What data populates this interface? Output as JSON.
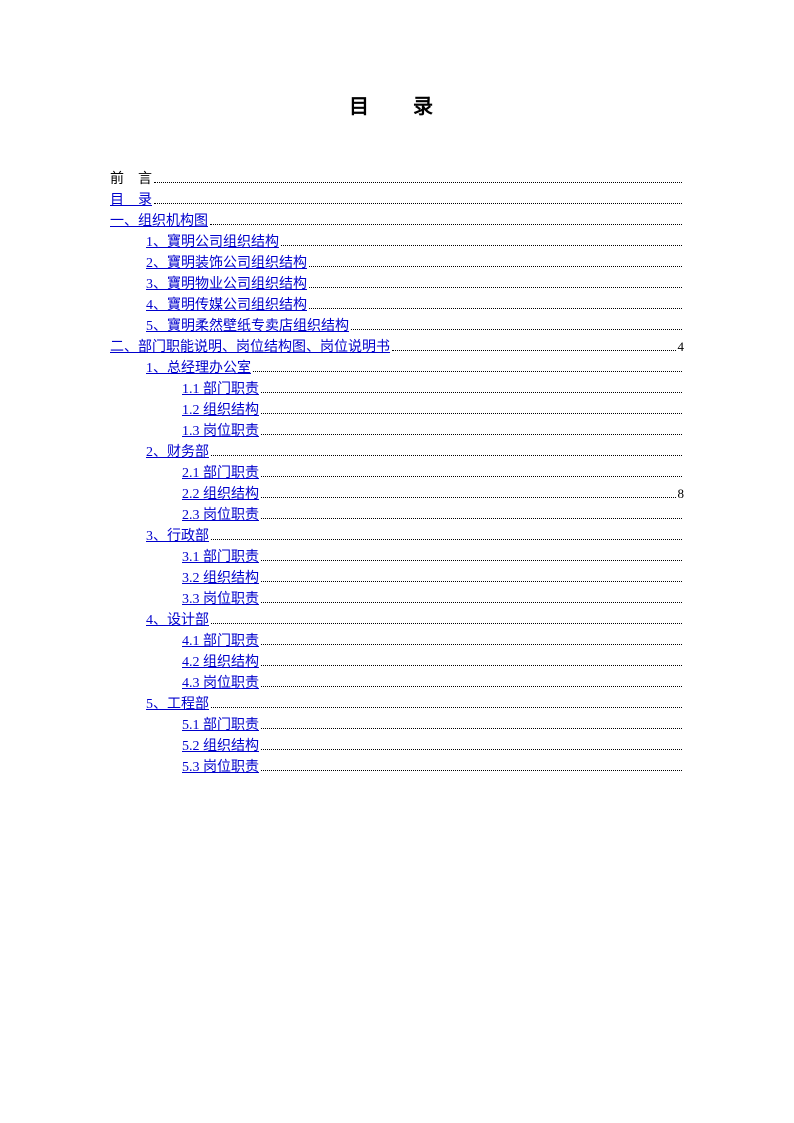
{
  "title": "目　录",
  "entries": [
    {
      "label": "前　言",
      "indent": 0,
      "link": false,
      "page": ""
    },
    {
      "label": "目　录",
      "indent": 0,
      "link": true,
      "page": ""
    },
    {
      "label": "一、组织机构图",
      "indent": 0,
      "link": true,
      "page": ""
    },
    {
      "label": "1、寶明公司组织结构",
      "indent": 1,
      "link": true,
      "page": ""
    },
    {
      "label": "2、寶明装饰公司组织结构",
      "indent": 1,
      "link": true,
      "page": ""
    },
    {
      "label": "3、寶明物业公司组织结构",
      "indent": 1,
      "link": true,
      "page": ""
    },
    {
      "label": "4、寶明传媒公司组织结构",
      "indent": 1,
      "link": true,
      "page": ""
    },
    {
      "label": "5、寶明柔然壁纸专卖店组织结构",
      "indent": 1,
      "link": true,
      "page": ""
    },
    {
      "label": "二、部门职能说明、岗位结构图、岗位说明书",
      "indent": 0,
      "link": true,
      "page": "4"
    },
    {
      "label": "1、总经理办公室",
      "indent": 1,
      "link": true,
      "page": ""
    },
    {
      "label": "1.1 部门职责",
      "indent": 2,
      "link": true,
      "page": ""
    },
    {
      "label": "1.2 组织结构",
      "indent": 2,
      "link": true,
      "page": ""
    },
    {
      "label": "1.3 岗位职责",
      "indent": 2,
      "link": true,
      "page": ""
    },
    {
      "label": "2、财务部",
      "indent": 1,
      "link": true,
      "page": ""
    },
    {
      "label": "2.1 部门职责",
      "indent": 2,
      "link": true,
      "page": ""
    },
    {
      "label": "2.2 组织结构",
      "indent": 2,
      "link": true,
      "page": "8"
    },
    {
      "label": "2.3 岗位职责",
      "indent": 2,
      "link": true,
      "page": ""
    },
    {
      "label": "3、行政部",
      "indent": 1,
      "link": true,
      "page": ""
    },
    {
      "label": "3.1 部门职责",
      "indent": 2,
      "link": true,
      "page": ""
    },
    {
      "label": "3.2 组织结构",
      "indent": 2,
      "link": true,
      "page": ""
    },
    {
      "label": "3.3 岗位职责",
      "indent": 2,
      "link": true,
      "page": ""
    },
    {
      "label": "4、设计部",
      "indent": 1,
      "link": true,
      "page": ""
    },
    {
      "label": "4.1 部门职责",
      "indent": 2,
      "link": true,
      "page": ""
    },
    {
      "label": "4.2 组织结构",
      "indent": 2,
      "link": true,
      "page": ""
    },
    {
      "label": "4.3 岗位职责",
      "indent": 2,
      "link": true,
      "page": ""
    },
    {
      "label": "5、工程部",
      "indent": 1,
      "link": true,
      "page": ""
    },
    {
      "label": "5.1 部门职责",
      "indent": 2,
      "link": true,
      "page": ""
    },
    {
      "label": "5.2 组织结构",
      "indent": 2,
      "link": true,
      "page": ""
    },
    {
      "label": "5.3 岗位职责",
      "indent": 2,
      "link": true,
      "page": ""
    }
  ]
}
